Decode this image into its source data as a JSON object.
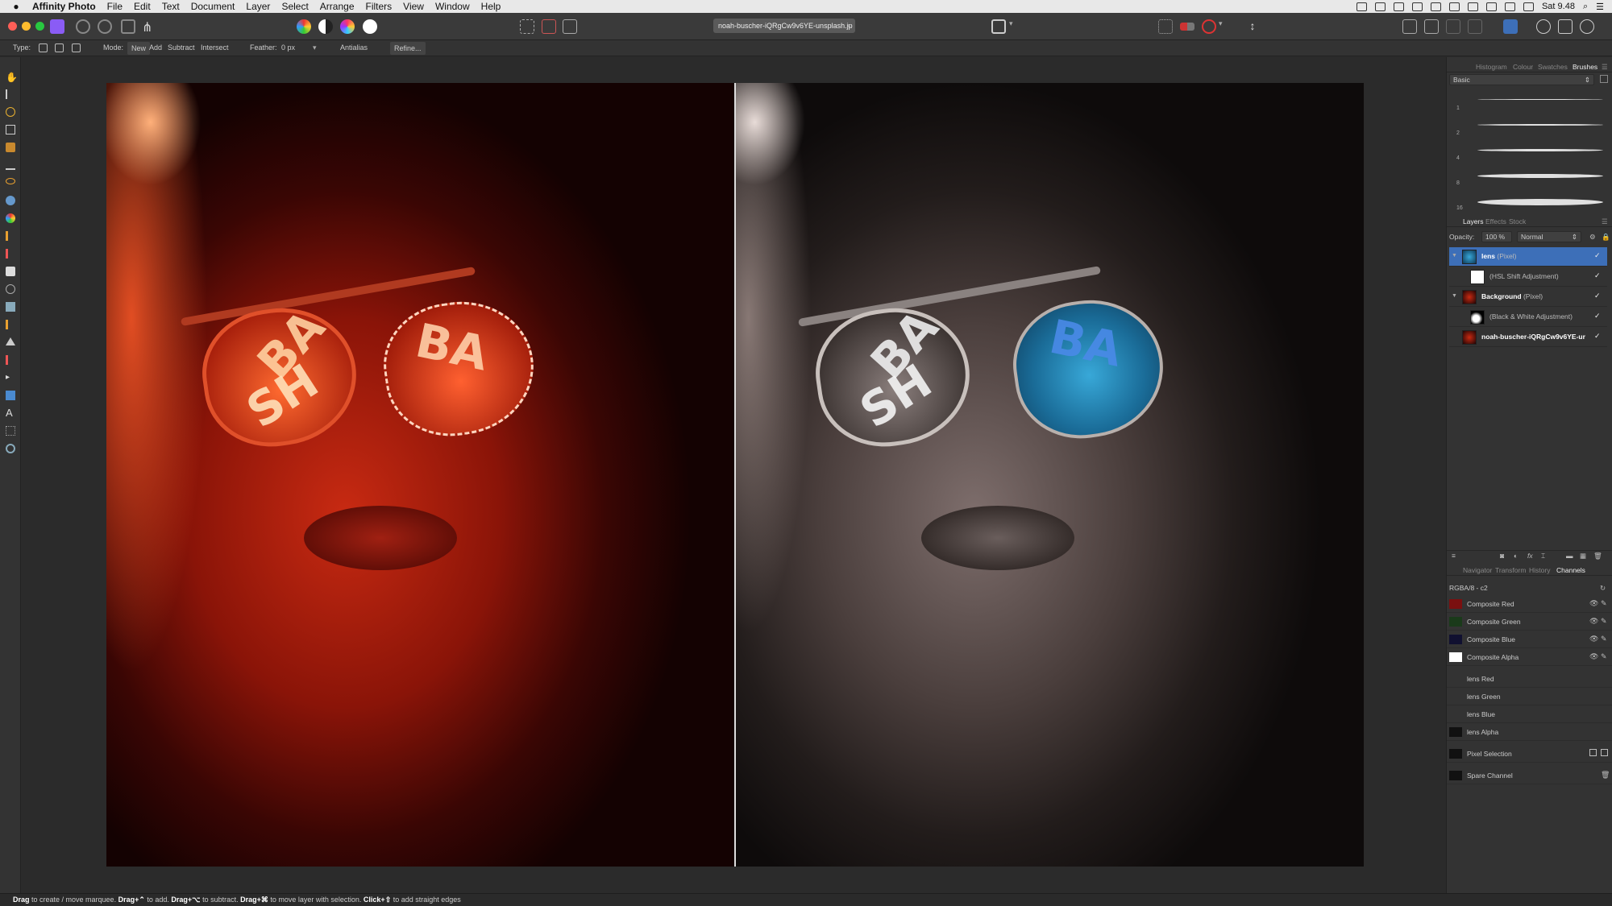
{
  "menubar": {
    "app_name": "Affinity Photo",
    "menus": [
      "File",
      "Edit",
      "Text",
      "Document",
      "Layer",
      "Select",
      "Arrange",
      "Filters",
      "View",
      "Window",
      "Help"
    ],
    "clock": "Sat 9.48"
  },
  "toolbar": {
    "document_tab": "noah-buscher-iQRgCw9v6YE-unsplash.jp",
    "document_tab_close": "×"
  },
  "context": {
    "type_label": "Type:",
    "mode_label": "Mode:",
    "mode_new": "New",
    "mode_add": "Add",
    "mode_subtract": "Subtract",
    "mode_intersect": "Intersect",
    "feather_label": "Feather:",
    "feather_value": "0 px",
    "antialias_label": "Antialias",
    "refine_label": "Refine..."
  },
  "canvas": {
    "left_lens_text_1": "BA",
    "left_lens_text_2": "SH",
    "right_lens_text_1": "BA",
    "right_lens_text_2": "SH"
  },
  "brushes_panel": {
    "tabs": [
      "Histogram",
      "Colour",
      "Swatches",
      "Brushes"
    ],
    "active_tab": "Brushes",
    "category": "Basic",
    "brushes": [
      {
        "size": "1"
      },
      {
        "size": "2"
      },
      {
        "size": "4"
      },
      {
        "size": "8"
      },
      {
        "size": "16"
      }
    ]
  },
  "layers_panel": {
    "tabs": [
      "Layers",
      "Effects",
      "Stock"
    ],
    "active_tab": "Layers",
    "opacity_label": "Opacity:",
    "opacity_value": "100 %",
    "blend_mode": "Normal",
    "layers": [
      {
        "name": "lens",
        "type": "(Pixel)",
        "selected": true
      },
      {
        "name": "",
        "type": "(HSL Shift Adjustment)",
        "selected": false
      },
      {
        "name": "Background",
        "type": "(Pixel)",
        "selected": false
      },
      {
        "name": "",
        "type": "(Black & White Adjustment)",
        "selected": false
      },
      {
        "name": "noah-buscher-iQRgCw9v6YE-ur",
        "type": "",
        "selected": false
      }
    ]
  },
  "channels_panel": {
    "tabs": [
      "Navigator",
      "Transform",
      "History",
      "Channels"
    ],
    "active_tab": "Channels",
    "format": "RGBA/8 - c2",
    "composite": [
      {
        "label": "Composite Red",
        "color": "#7a1010"
      },
      {
        "label": "Composite Green",
        "color": "#1a3a1a"
      },
      {
        "label": "Composite Blue",
        "color": "#101030"
      },
      {
        "label": "Composite Alpha",
        "color": "#ffffff"
      }
    ],
    "layer_channels": [
      {
        "label": "lens Red"
      },
      {
        "label": "lens Green"
      },
      {
        "label": "lens Blue"
      },
      {
        "label": "lens Alpha"
      }
    ],
    "pixel_selection": "Pixel Selection",
    "spare_channel": "Spare Channel"
  },
  "status": {
    "drag1": "Drag",
    "t1": " to create / move marquee. ",
    "drag2": "Drag+⌃",
    "t2": " to add. ",
    "drag3": "Drag+⌥",
    "t3": " to subtract. ",
    "drag4": "Drag+⌘",
    "t4": " to move layer with selection. ",
    "click": "Click+⇧",
    "t5": " to add straight edges"
  },
  "colors": {
    "accent_selected": "#3d6fb8",
    "toolbar_bg": "#3a3a3a",
    "panel_bg": "#333333"
  }
}
